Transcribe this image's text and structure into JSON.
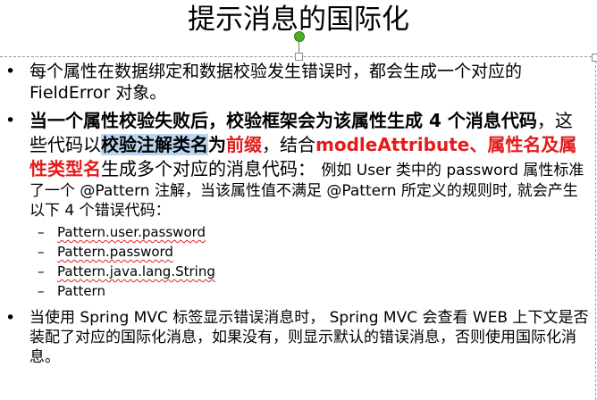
{
  "slide": {
    "title": "提示消息的国际化",
    "bullet_char": "•",
    "dash_char": "–",
    "bullet1": "每个属性在数据绑定和数据校验发生错误时，都会生成一个对应的 FieldError 对象。",
    "bullet2": {
      "part_bold1": "当一个属性校验失败后，校验框架会为该属性生成 4 个消息代码",
      "part_normal1": "，这些代码以",
      "part_highlight": "校验注解类名",
      "part_bold_wei": "为",
      "part_red1": "前缀",
      "part_normal2": "，结合",
      "part_red2": "modleAttribute、属性名及属性类型名",
      "part_normal3": "生成多个对应的消息代码：",
      "part_small": "例如 User 类中的 password 属性标准了一个 @Pattern 注解，当该属性值不满足 @Pattern 所定义的规则时, 就会产生以下 4 个错误代码："
    },
    "codes": [
      "Pattern.user.password",
      "Pattern.password",
      "Pattern.java.lang.String",
      "Pattern"
    ],
    "bullet3": "当使用 Spring MVC 标签显示错误消息时， Spring MVC 会查看 WEB 上下文是否装配了对应的国际化消息，如果没有，则显示默认的错误消息，否则使用国际化消息。"
  },
  "colors": {
    "emphasis_red": "#e31b1b",
    "text_highlight": "#bcd5ee",
    "rotate_handle": "#4caf28"
  }
}
